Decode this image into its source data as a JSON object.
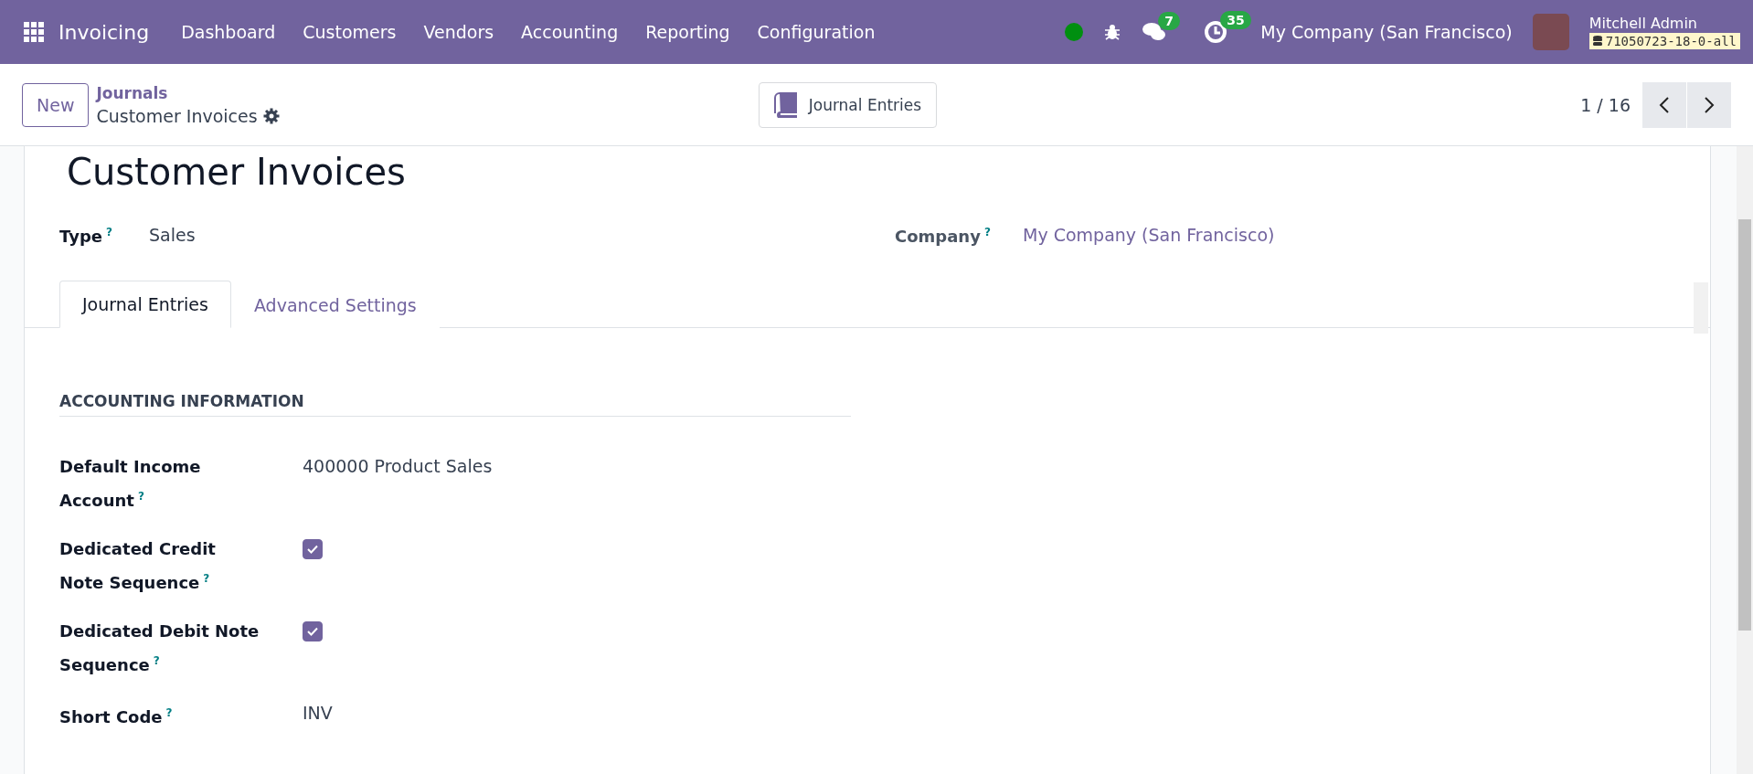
{
  "navbar": {
    "app_name": "Invoicing",
    "menu": [
      "Dashboard",
      "Customers",
      "Vendors",
      "Accounting",
      "Reporting",
      "Configuration"
    ],
    "messages_count": "7",
    "activities_count": "35",
    "company": "My Company (San Francisco)",
    "user_name": "Mitchell Admin",
    "database": "71050723-18-0-all"
  },
  "control_panel": {
    "new_button": "New",
    "breadcrumb_parent": "Journals",
    "breadcrumb_current": "Customer Invoices",
    "smart_button": "Journal Entries",
    "pager": "1 / 16"
  },
  "form": {
    "title": "Customer Invoices",
    "header_fields": [
      {
        "label": "Type",
        "help": "?",
        "value": "Sales",
        "kind": "text"
      },
      {
        "label": "Company",
        "help": "?",
        "value": "My Company (San Francisco)",
        "kind": "link"
      }
    ],
    "tabs": [
      {
        "label": "Journal Entries",
        "selected": true
      },
      {
        "label": "Advanced Settings",
        "selected": false
      }
    ],
    "section_title": "ACCOUNTING INFORMATION",
    "fields": [
      {
        "label": "Default Income Account",
        "help": "?",
        "kind": "text",
        "value": "400000 Product Sales"
      },
      {
        "label": "Dedicated Credit Note Sequence",
        "help": "?",
        "kind": "checkbox",
        "checked": true
      },
      {
        "label": "Dedicated Debit Note Sequence",
        "help": "?",
        "kind": "checkbox",
        "checked": true
      },
      {
        "label": "Short Code",
        "help": "?",
        "kind": "text",
        "value": "INV"
      }
    ]
  }
}
